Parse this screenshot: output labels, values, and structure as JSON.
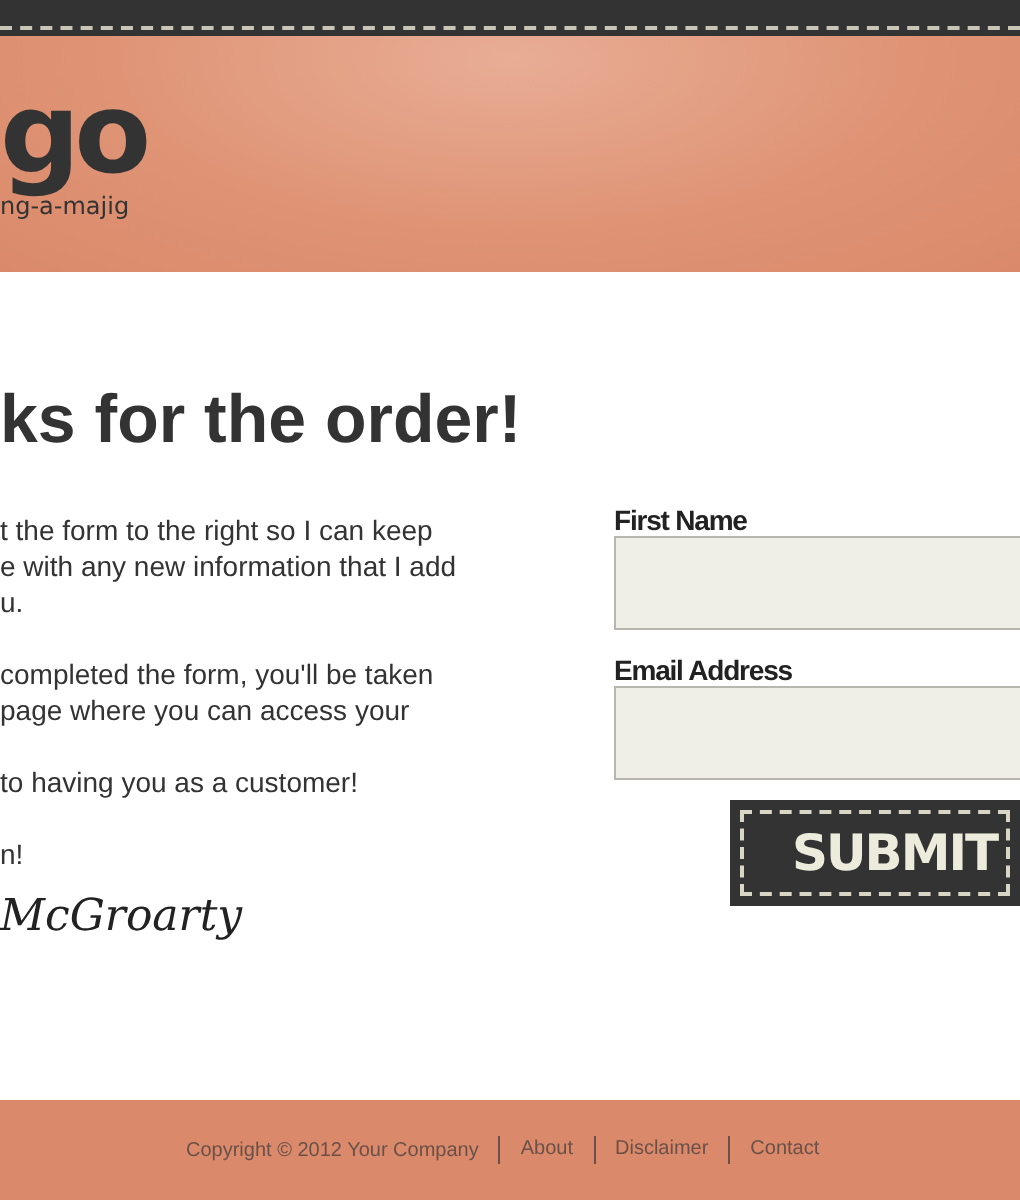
{
  "header": {
    "logo": "go",
    "tagline": "ng-a-majig"
  },
  "heading": "ks for the order!",
  "paragraphs": [
    [
      "t the form to the right so I can keep",
      "e with any new information that I add",
      "u."
    ],
    [
      "completed the form, you'll be taken",
      "page where you can access your"
    ],
    [
      "to having you as a customer!"
    ],
    [
      "n!"
    ]
  ],
  "signature": "McGroarty",
  "form": {
    "fields": [
      {
        "label": "First Name"
      },
      {
        "label": "Email Address"
      }
    ],
    "submit": "SUBMIT"
  },
  "footer": {
    "copyright": "Copyright © 2012 Your Company",
    "links": [
      "About",
      "Disclaimer",
      "Contact"
    ]
  }
}
